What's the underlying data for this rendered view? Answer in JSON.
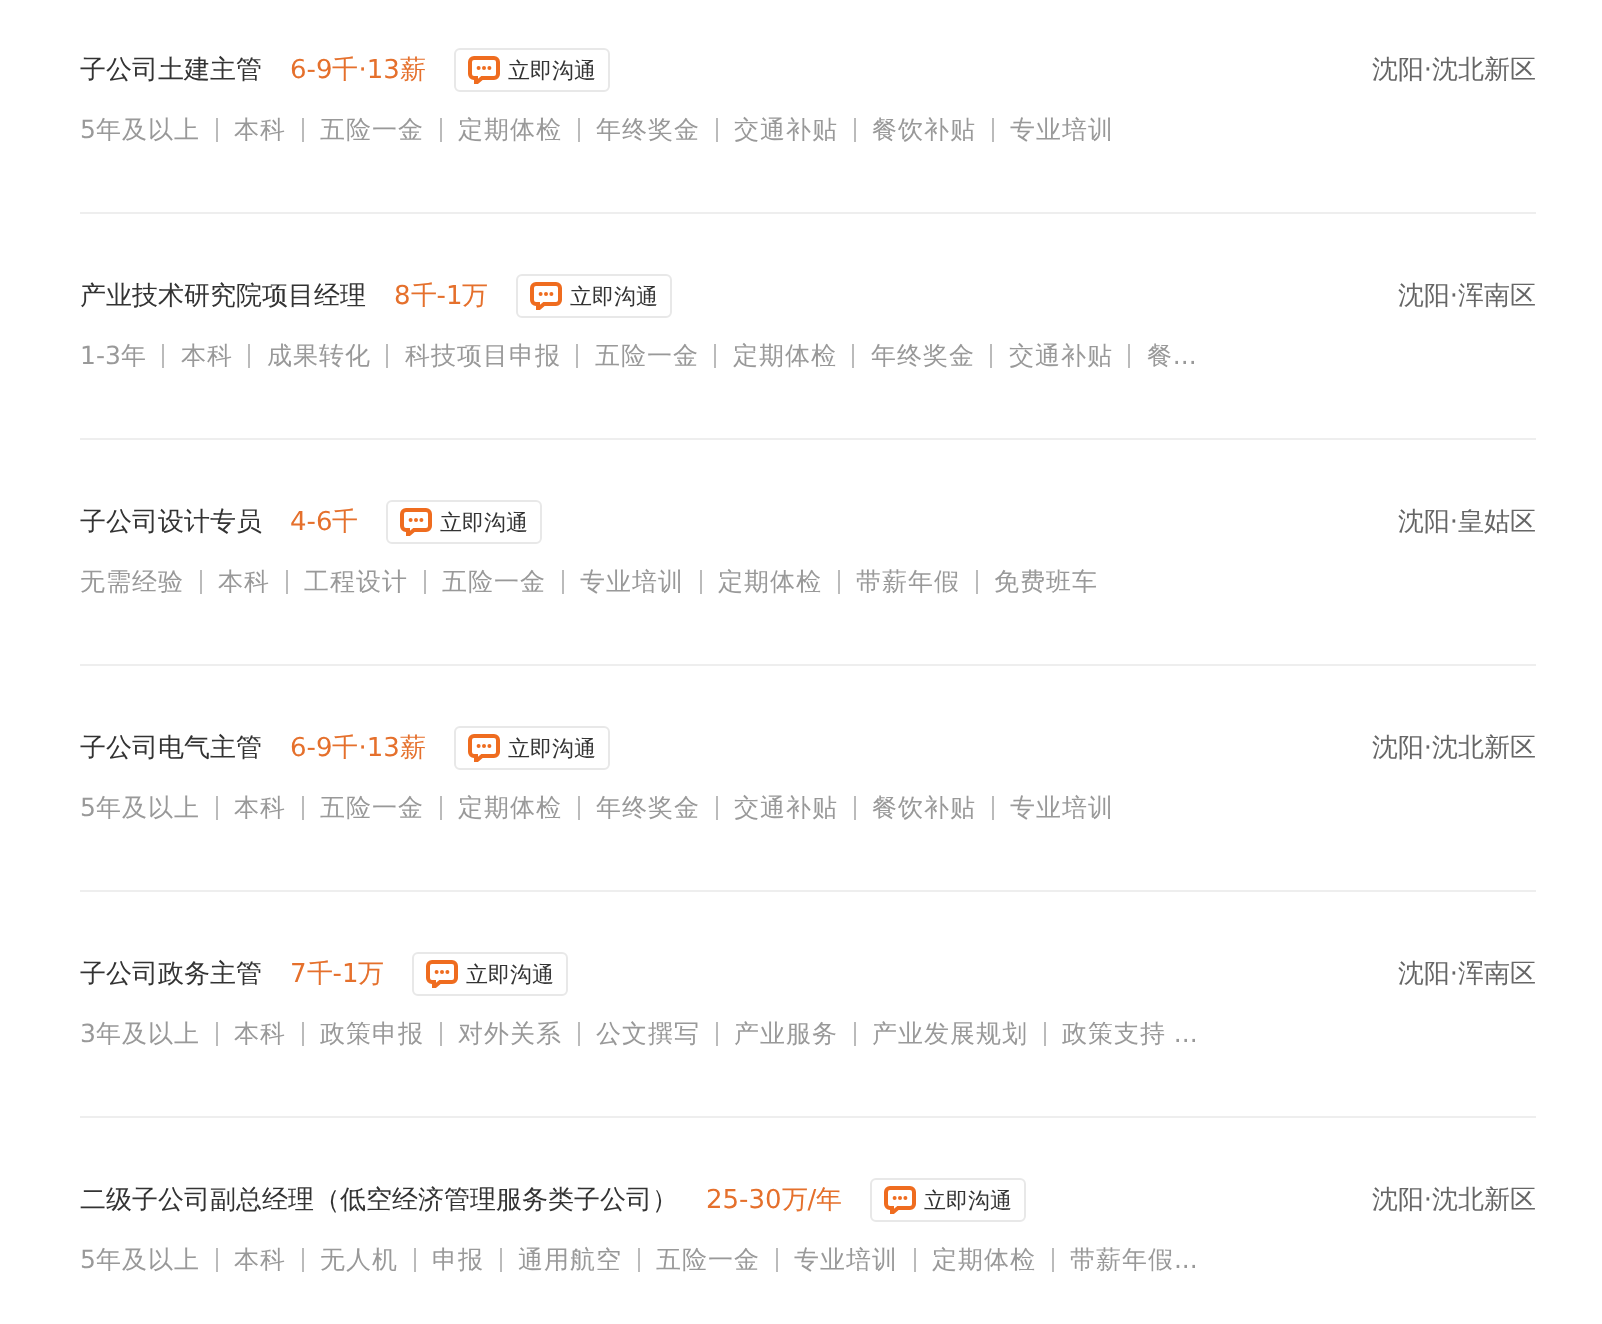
{
  "jobs": [
    {
      "title": "子公司土建主管",
      "salary": "6-9千·13薪",
      "chat_button": "立即沟通",
      "location": "沈阳·沈北新区",
      "tags": [
        "5年及以上",
        "本科",
        "五险一金",
        "定期体检",
        "年终奖金",
        "交通补贴",
        "餐饮补贴",
        "专业培训"
      ]
    },
    {
      "title": "产业技术研究院项目经理",
      "salary": "8千-1万",
      "chat_button": "立即沟通",
      "location": "沈阳·浑南区",
      "tags": [
        "1-3年",
        "本科",
        "成果转化",
        "科技项目申报",
        "五险一金",
        "定期体检",
        "年终奖金",
        "交通补贴",
        "餐..."
      ]
    },
    {
      "title": "子公司设计专员",
      "salary": "4-6千",
      "chat_button": "立即沟通",
      "location": "沈阳·皇姑区",
      "tags": [
        "无需经验",
        "本科",
        "工程设计",
        "五险一金",
        "专业培训",
        "定期体检",
        "带薪年假",
        "免费班车"
      ]
    },
    {
      "title": "子公司电气主管",
      "salary": "6-9千·13薪",
      "chat_button": "立即沟通",
      "location": "沈阳·沈北新区",
      "tags": [
        "5年及以上",
        "本科",
        "五险一金",
        "定期体检",
        "年终奖金",
        "交通补贴",
        "餐饮补贴",
        "专业培训"
      ]
    },
    {
      "title": "子公司政务主管",
      "salary": "7千-1万",
      "chat_button": "立即沟通",
      "location": "沈阳·浑南区",
      "tags": [
        "3年及以上",
        "本科",
        "政策申报",
        "对外关系",
        "公文撰写",
        "产业服务",
        "产业发展规划",
        "政策支持 ..."
      ]
    },
    {
      "title": "二级子公司副总经理（低空经济管理服务类子公司）",
      "salary": "25-30万/年",
      "chat_button": "立即沟通",
      "location": "沈阳·沈北新区",
      "tags": [
        "5年及以上",
        "本科",
        "无人机",
        "申报",
        "通用航空",
        "五险一金",
        "专业培训",
        "定期体检",
        "带薪年假..."
      ]
    }
  ]
}
